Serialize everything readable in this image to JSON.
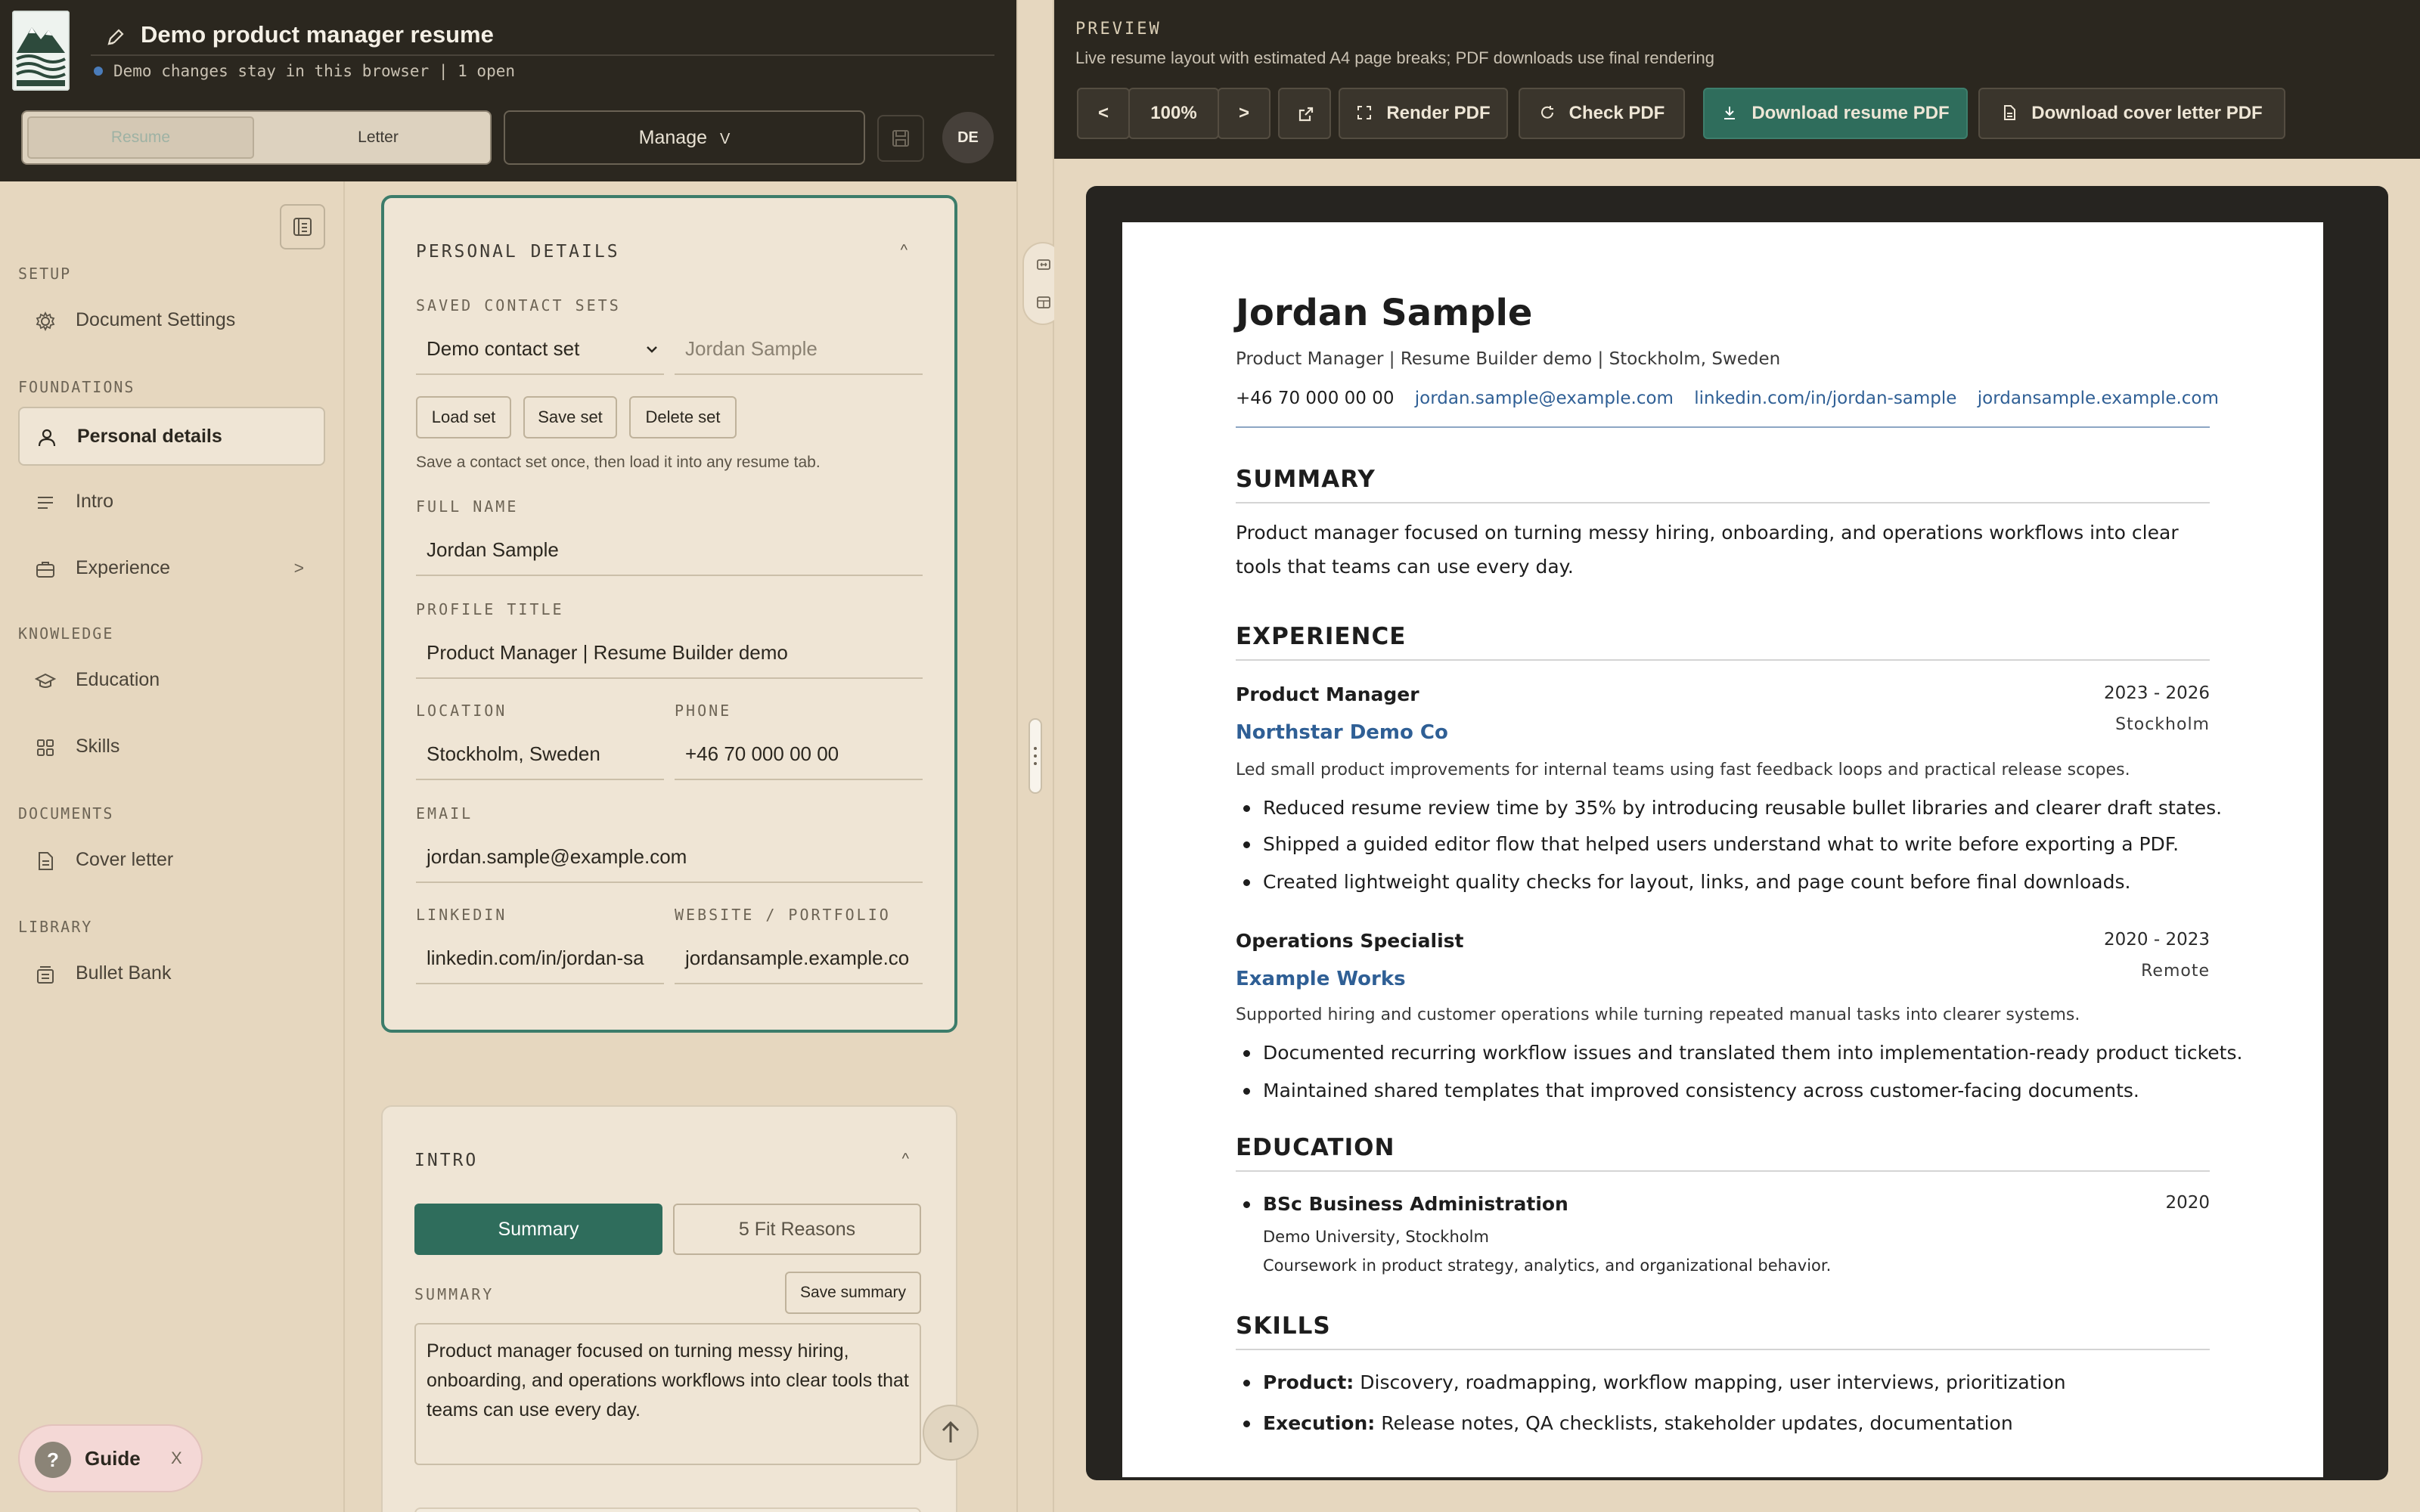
{
  "header": {
    "doc_title": "Demo product manager resume",
    "status_text": "Demo changes stay in this browser | 1 open",
    "mode_tabs": [
      "Resume",
      "Letter"
    ],
    "manage_label": "Manage",
    "manage_chevron": "V",
    "language": "DE"
  },
  "sidebar": {
    "sections": [
      {
        "label": "SETUP",
        "items": [
          {
            "label": "Document Settings",
            "icon": "gear-icon"
          }
        ]
      },
      {
        "label": "FOUNDATIONS",
        "items": [
          {
            "label": "Personal details",
            "icon": "person-icon",
            "active": true
          },
          {
            "label": "Intro",
            "icon": "lines-icon"
          },
          {
            "label": "Experience",
            "icon": "briefcase-icon",
            "chevron": ">"
          }
        ]
      },
      {
        "label": "KNOWLEDGE",
        "items": [
          {
            "label": "Education",
            "icon": "graduation-cap-icon"
          },
          {
            "label": "Skills",
            "icon": "grid-icon"
          }
        ]
      },
      {
        "label": "DOCUMENTS",
        "items": [
          {
            "label": "Cover letter",
            "icon": "document-icon"
          }
        ]
      },
      {
        "label": "LIBRARY",
        "items": [
          {
            "label": "Bullet Bank",
            "icon": "stack-icon"
          }
        ]
      }
    ],
    "guide": {
      "label": "Guide",
      "icon_text": "?",
      "close": "X"
    }
  },
  "personal": {
    "title": "PERSONAL DETAILS",
    "caret": "^",
    "saved_sets_label": "SAVED CONTACT SETS",
    "contact_set_value": "Demo contact set",
    "set_name_placeholder": "Jordan Sample",
    "buttons": {
      "load": "Load set",
      "save": "Save set",
      "delete": "Delete set"
    },
    "hint": "Save a contact set once, then load it into any resume tab.",
    "fields": {
      "full_name": {
        "label": "FULL NAME",
        "value": "Jordan Sample"
      },
      "profile_title": {
        "label": "PROFILE TITLE",
        "value": "Product Manager | Resume Builder demo"
      },
      "location": {
        "label": "LOCATION",
        "value": "Stockholm, Sweden"
      },
      "phone": {
        "label": "PHONE",
        "value": "+46 70 000 00 00"
      },
      "email": {
        "label": "EMAIL",
        "value": "jordan.sample@example.com"
      },
      "linkedin": {
        "label": "LINKEDIN",
        "value": "linkedin.com/in/jordan-sa"
      },
      "website": {
        "label": "WEBSITE / PORTFOLIO",
        "value": "jordansample.example.co"
      }
    }
  },
  "intro": {
    "title": "INTRO",
    "caret": "^",
    "tabs": [
      "Summary",
      "5 Fit Reasons"
    ],
    "summary_label": "SUMMARY",
    "save_summary": "Save summary",
    "summary_text": "Product manager focused on turning messy hiring, onboarding, and operations workflows into clear tools that teams can use every day."
  },
  "preview": {
    "label": "PREVIEW",
    "subtitle": "Live resume layout with estimated A4 page breaks; PDF downloads use final rendering",
    "toolbar": {
      "prev": "<",
      "zoom": "100%",
      "next": ">",
      "render": "Render PDF",
      "check": "Check PDF",
      "download_resume": "Download resume PDF",
      "download_letter": "Download cover letter PDF"
    }
  },
  "resume": {
    "name": "Jordan Sample",
    "title_line": "Product Manager | Resume Builder demo | Stockholm, Sweden",
    "contact": {
      "phone": "+46 70 000 00 00",
      "email": "jordan.sample@example.com",
      "linkedin": "linkedin.com/in/jordan-sample",
      "website": "jordansample.example.com"
    },
    "summary_heading": "SUMMARY",
    "summary": "Product manager focused on turning messy hiring, onboarding, and operations workflows into clear tools that teams can use every day.",
    "experience_heading": "EXPERIENCE",
    "jobs": [
      {
        "role": "Product Manager",
        "dates": "2023 - 2026",
        "company": "Northstar Demo Co",
        "location": "Stockholm",
        "desc": "Led small product improvements for internal teams using fast feedback loops and practical release scopes.",
        "bullets": [
          "Reduced resume review time by 35% by introducing reusable bullet libraries and clearer draft states.",
          "Shipped a guided editor flow that helped users understand what to write before exporting a PDF.",
          "Created lightweight quality checks for layout, links, and page count before final downloads."
        ]
      },
      {
        "role": "Operations Specialist",
        "dates": "2020 - 2023",
        "company": "Example Works",
        "location": "Remote",
        "desc": "Supported hiring and customer operations while turning repeated manual tasks into clearer systems.",
        "bullets": [
          "Documented recurring workflow issues and translated them into implementation-ready product tickets.",
          "Maintained shared templates that improved consistency across customer-facing documents."
        ]
      }
    ],
    "education_heading": "EDUCATION",
    "education": {
      "degree": "BSc Business Administration",
      "year": "2020",
      "school": "Demo University, Stockholm",
      "note": "Coursework in product strategy, analytics, and organizational behavior."
    },
    "skills_heading": "SKILLS",
    "skills": [
      {
        "name": "Product:",
        "value": "Discovery, roadmapping, workflow mapping, user interviews, prioritization"
      },
      {
        "name": "Execution:",
        "value": "Release notes, QA checklists, stakeholder updates, documentation"
      }
    ]
  }
}
